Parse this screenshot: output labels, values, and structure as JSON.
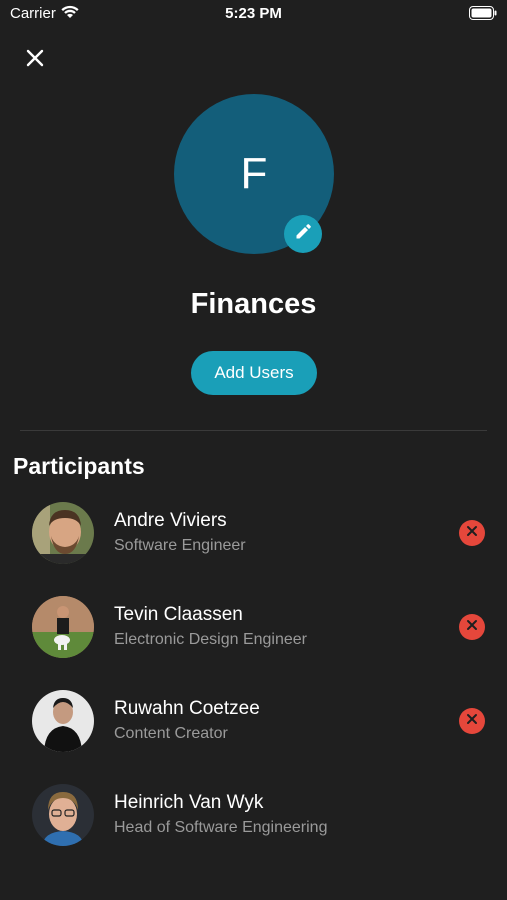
{
  "status_bar": {
    "carrier": "Carrier",
    "time": "5:23 PM"
  },
  "group": {
    "initial": "F",
    "name": "Finances",
    "avatar_color": "#135e7a"
  },
  "actions": {
    "add_users_label": "Add Users"
  },
  "participants": {
    "heading": "Participants",
    "items": [
      {
        "name": "Andre Viviers",
        "role": "Software Engineer",
        "removable": true
      },
      {
        "name": "Tevin Claassen",
        "role": "Electronic Design Engineer",
        "removable": true
      },
      {
        "name": "Ruwahn Coetzee",
        "role": "Content Creator",
        "removable": true
      },
      {
        "name": "Heinrich Van Wyk",
        "role": "Head of Software Engineering",
        "removable": false
      }
    ]
  },
  "icons": {
    "close": "close-icon",
    "edit": "pencil-icon",
    "remove": "remove-x-icon"
  },
  "colors": {
    "background": "#1f1f1f",
    "accent": "#1a9fb8",
    "danger": "#e5473b",
    "secondary_text": "#9a9a9a"
  }
}
